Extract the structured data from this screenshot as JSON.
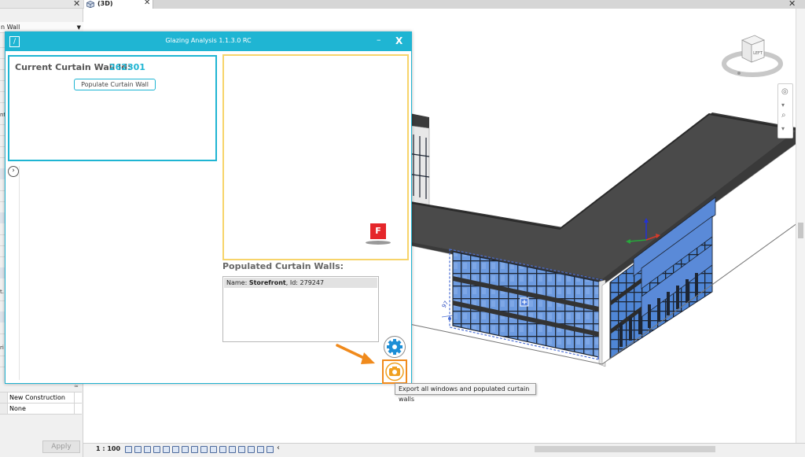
{
  "properties": {
    "type_selector_partial": "n Wall",
    "side_fragments": [
      "nt",
      "t.",
      "ri"
    ],
    "rows": [
      {
        "value": "New Construction"
      },
      {
        "value": "None"
      }
    ],
    "apply_label": "Apply",
    "close_glyph": "✕",
    "section_marker": "≈"
  },
  "view_tab": {
    "label": "(3D)",
    "close_glyph": "✕"
  },
  "window": {
    "close_glyph": "✕"
  },
  "viewcube": {
    "face_label": "LEFT"
  },
  "status_bar": {
    "scale": "1 : 100",
    "chevron": "‹"
  },
  "dialog": {
    "title": "Glazing Analysis 1.1.3.0 RC",
    "logo_glyph": "/",
    "minimize_glyph": "–",
    "close_glyph": "X",
    "current_wall_label": "Current Curtain Wall Id:",
    "current_wall_id": "262301",
    "populate_button": "Populate Curtain Wall",
    "expander_glyph": "›",
    "preview_logo": "F",
    "populated_heading": "Populated Curtain Walls:",
    "populated_list": [
      {
        "prefix": "Name: ",
        "name": "Storefront",
        "suffix": ", Id: 279247"
      }
    ],
    "export_tooltip": "Export all windows and populated curtain walls"
  },
  "model": {
    "dimension_label": "97"
  },
  "colors": {
    "dialog_accent": "#1fb5d3",
    "preview_border": "#f7d46a",
    "export_accent": "#f08a1c",
    "glazing_blue": "#5e8fd8",
    "roof": "#4a4a4a"
  }
}
